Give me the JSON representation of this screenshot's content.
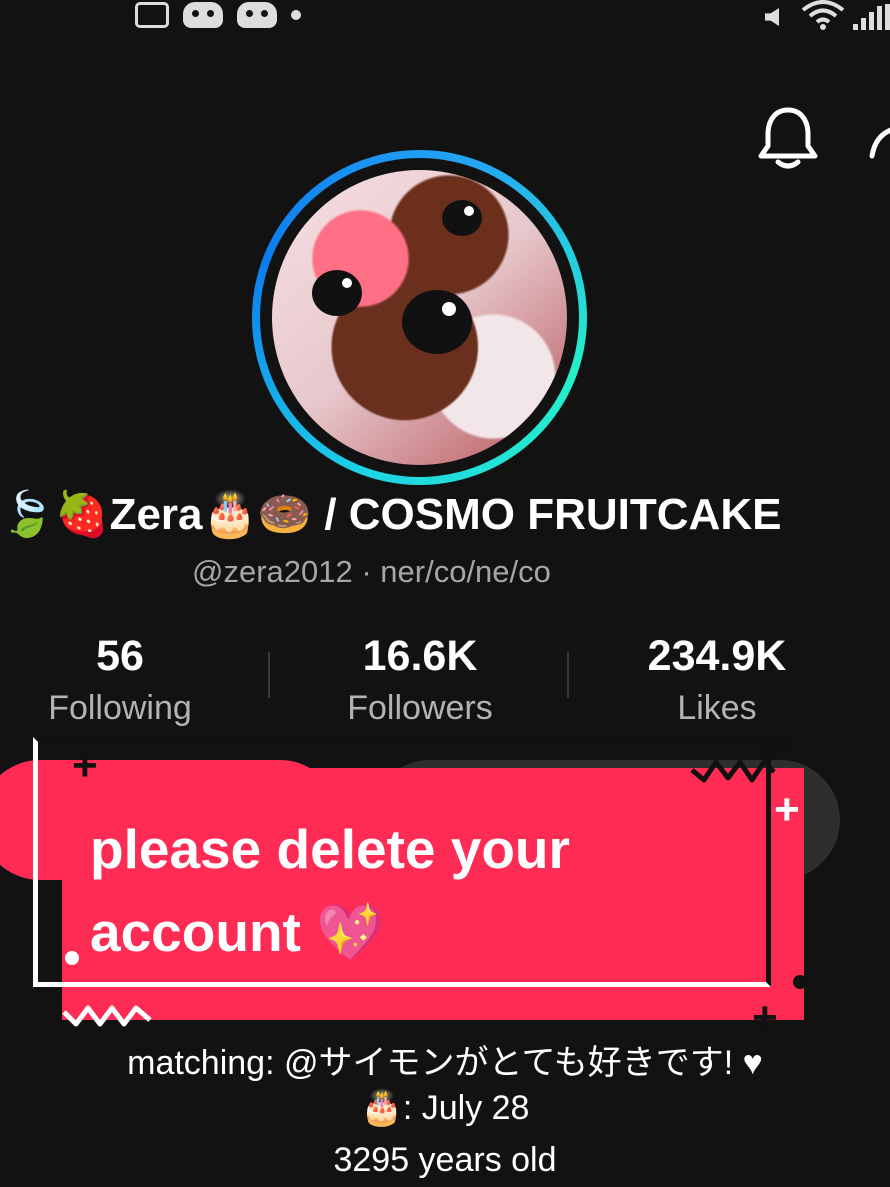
{
  "status_bar": {
    "left_icons": [
      "screen-record-icon",
      "game-controller-icon",
      "game-controller-icon",
      "notification-dot-icon"
    ],
    "right_icons": [
      "mute-icon",
      "wifi-icon",
      "signal-icon"
    ]
  },
  "header": {
    "icons": [
      "bell-icon",
      "share-icon"
    ]
  },
  "profile": {
    "display_name_prefix": "🍃🍓",
    "display_name": "Zera",
    "display_name_emojis": "🎂🍩",
    "display_name_suffix": " / COSMO FRUITCAKE",
    "username": "@zera2012 · ner/co/ne/co"
  },
  "stats": [
    {
      "value": "56",
      "label": "Following"
    },
    {
      "value": "16.6K",
      "label": "Followers"
    },
    {
      "value": "234.9K",
      "label": "Likes"
    }
  ],
  "sticker": {
    "line1": "please delete your",
    "line2": "account 💖"
  },
  "bio": {
    "line_matching": "matching: @サイモンがとても好きです! ♥",
    "line_birthday": "🎂: July 28",
    "line_age": "3295 years old"
  },
  "colors": {
    "accent": "#fe2c55",
    "background": "#121212",
    "secondary_text": "#a6a6a6",
    "ring_start": "#0c7cf0",
    "ring_end": "#25f0c8"
  }
}
